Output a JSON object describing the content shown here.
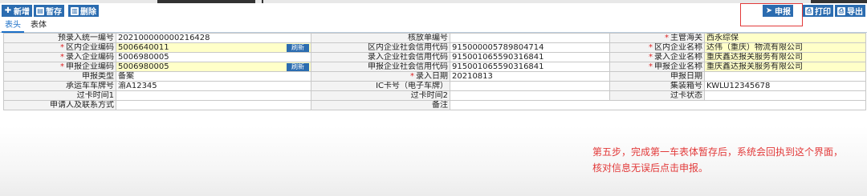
{
  "toolbar": {
    "add_label": "新增",
    "save_label": "暂存",
    "delete_label": "删除",
    "declare_label": "申报",
    "print_label": "打印",
    "export_label": "导出"
  },
  "tabs": [
    {
      "label": "表头"
    },
    {
      "label": "表体"
    }
  ],
  "form": {
    "r1": {
      "l1": "预录入统一编号",
      "v1": "202100000000216428",
      "l2": "核放单编号",
      "v2": "",
      "l3": "主管海关",
      "v3": "西永综保"
    },
    "r2": {
      "l1": "区内企业编码",
      "v1": "5006640011",
      "btn": "刷新",
      "l2": "区内企业社会信用代码",
      "v2": "915000005789804714",
      "l3": "区内企业名称",
      "v3": "达伟（重庆）物流有限公司"
    },
    "r3": {
      "l1": "录入企业编码",
      "v1": "5006980005",
      "l2": "录入企业社会信用代码",
      "v2": "915001065590316841",
      "l3": "录入企业名称",
      "v3": "重庆鑫达报关服务有限公司"
    },
    "r4": {
      "l1": "申报企业编码",
      "v1": "5006980005",
      "btn": "刷新",
      "l2": "申报企业社会信用代码",
      "v2": "915001065590316841",
      "l3": "申报企业名称",
      "v3": "重庆鑫达报关服务有限公司"
    },
    "r5": {
      "l1": "申报类型",
      "v1": "备案",
      "l2": "录入日期",
      "v2": "20210813",
      "l3": "申报日期",
      "v3": ""
    },
    "r6": {
      "l1": "承运车车牌号",
      "v1": "渝A12345",
      "l2": "IC卡号（电子车牌）",
      "v2": "",
      "l3": "集装箱号",
      "v3": "KWLU12345678"
    },
    "r7": {
      "l1": "过卡时间1",
      "v1": "",
      "l2": "过卡时间2",
      "v2": "",
      "l3": "过卡状态",
      "v3": ""
    },
    "r8": {
      "l1": "申请人及联系方式",
      "v1": "",
      "l2": "备注",
      "v2": ""
    }
  },
  "note": "第五步，完成第一车表体暂存后，系统会回执到这个界面，核对信息无误后点击申报。",
  "colors": {
    "button": "#2b6cb0",
    "required": "#dd2222",
    "highlight": "#ffffc8",
    "annotation": "#e23a3a"
  }
}
